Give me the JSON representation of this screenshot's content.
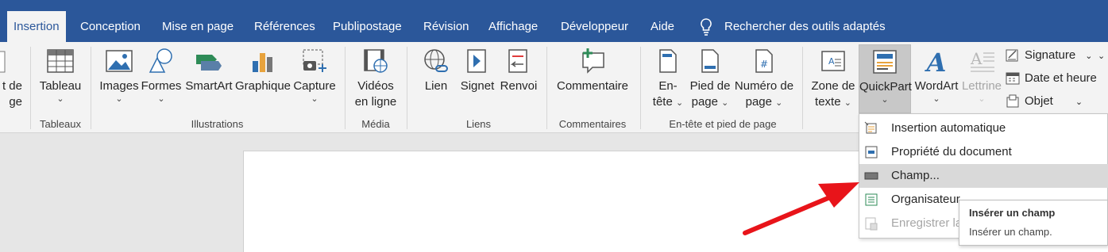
{
  "tabs": [
    {
      "label": "Insertion",
      "active": true
    },
    {
      "label": "Conception"
    },
    {
      "label": "Mise en page"
    },
    {
      "label": "Références"
    },
    {
      "label": "Publipostage"
    },
    {
      "label": "Révision"
    },
    {
      "label": "Affichage"
    },
    {
      "label": "Développeur"
    },
    {
      "label": "Aide"
    }
  ],
  "search": {
    "label": "Rechercher des outils adaptés",
    "icon": "lightbulb-icon"
  },
  "ribbon": {
    "partial": {
      "line1": "t de",
      "line2": "ge"
    },
    "tableau": {
      "label": "Tableau"
    },
    "images": {
      "label": "Images"
    },
    "formes": {
      "label": "Formes"
    },
    "smartart": {
      "label": "SmartArt"
    },
    "graphique": {
      "label": "Graphique"
    },
    "capture": {
      "label": "Capture"
    },
    "videos": {
      "line1": "Vidéos",
      "line2": "en ligne"
    },
    "lien": {
      "label": "Lien"
    },
    "signet": {
      "label": "Signet"
    },
    "renvoi": {
      "label": "Renvoi"
    },
    "commentaire": {
      "label": "Commentaire"
    },
    "entete": {
      "line1": "En-",
      "line2": "tête"
    },
    "pied": {
      "line1": "Pied de",
      "line2": "page"
    },
    "numero": {
      "line1": "Numéro de",
      "line2": "page"
    },
    "zone": {
      "line1": "Zone de",
      "line2": "texte"
    },
    "quickpart": {
      "label": "QuickPart"
    },
    "wordart": {
      "label": "WordArt"
    },
    "lettrine": {
      "label": "Lettrine"
    },
    "signature": {
      "label": "Signature"
    },
    "date": {
      "label": "Date et heure"
    },
    "objet": {
      "label": "Objet"
    },
    "chevron": "⌄",
    "groups": {
      "tableaux": "Tableaux",
      "illustrations": "Illustrations",
      "media": "Média",
      "liens": "Liens",
      "commentaires": "Commentaires",
      "entete_pied": "En-tête et pied de page"
    }
  },
  "menu": {
    "items": [
      {
        "label": "Insertion automatique"
      },
      {
        "label": "Propriété du document"
      },
      {
        "label": "Champ..."
      },
      {
        "label": "Organisateur"
      },
      {
        "label": "Enregistrer la"
      }
    ]
  },
  "tooltip": {
    "title": "Insérer un champ",
    "desc": "Insérer un champ."
  },
  "colors": {
    "tabbar": "#2b579a",
    "arrow": "#e8141a",
    "ribbon": "#f3f3f3"
  }
}
